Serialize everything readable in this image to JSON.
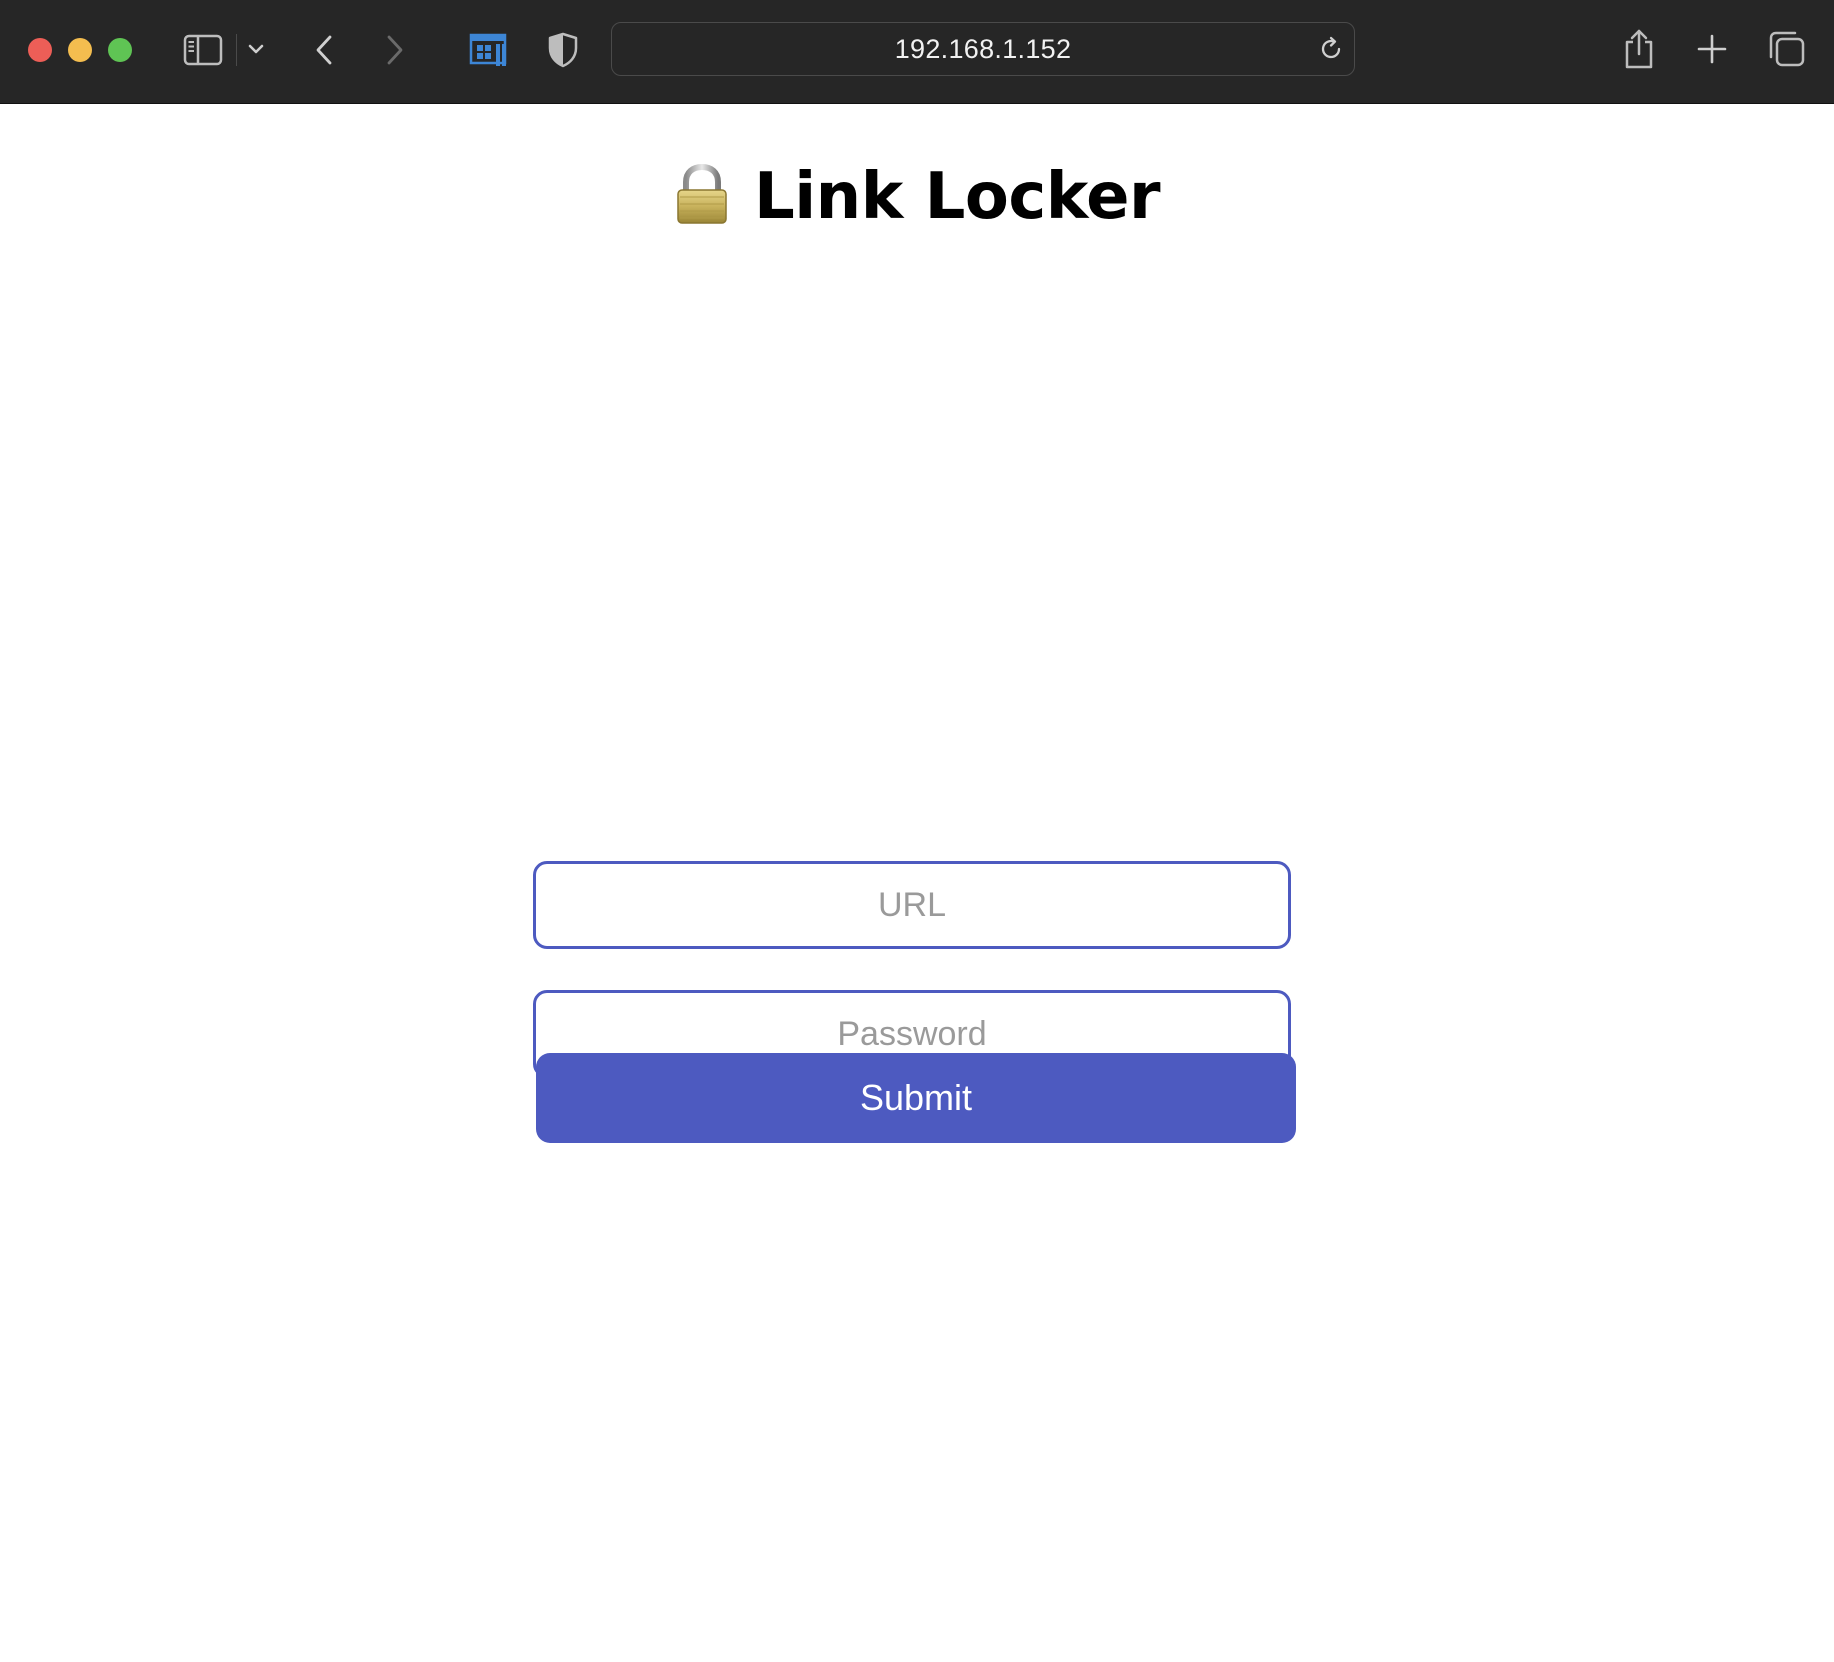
{
  "browser": {
    "url": "192.168.1.152",
    "icons": {
      "sidebar": "sidebar-icon",
      "tab_group_menu": "chevron-down-icon",
      "back": "chevron-left-icon",
      "forward": "chevron-right-icon",
      "extension": "extension-icon",
      "privacy": "shield-icon",
      "reload": "reload-icon",
      "share": "share-icon",
      "new_tab": "plus-icon",
      "tab_overview": "tabs-overview-icon"
    },
    "traffic_lights": {
      "close": "#ed5e57",
      "minimize": "#f4bd4f",
      "zoom": "#5fc454"
    }
  },
  "page": {
    "title_icon": "🔒",
    "title": "Link Locker",
    "url_field": {
      "placeholder": "URL",
      "value": ""
    },
    "password_field": {
      "placeholder": "Password",
      "value": ""
    },
    "submit_label": "Submit",
    "accent_color": "#4d5ac0"
  }
}
